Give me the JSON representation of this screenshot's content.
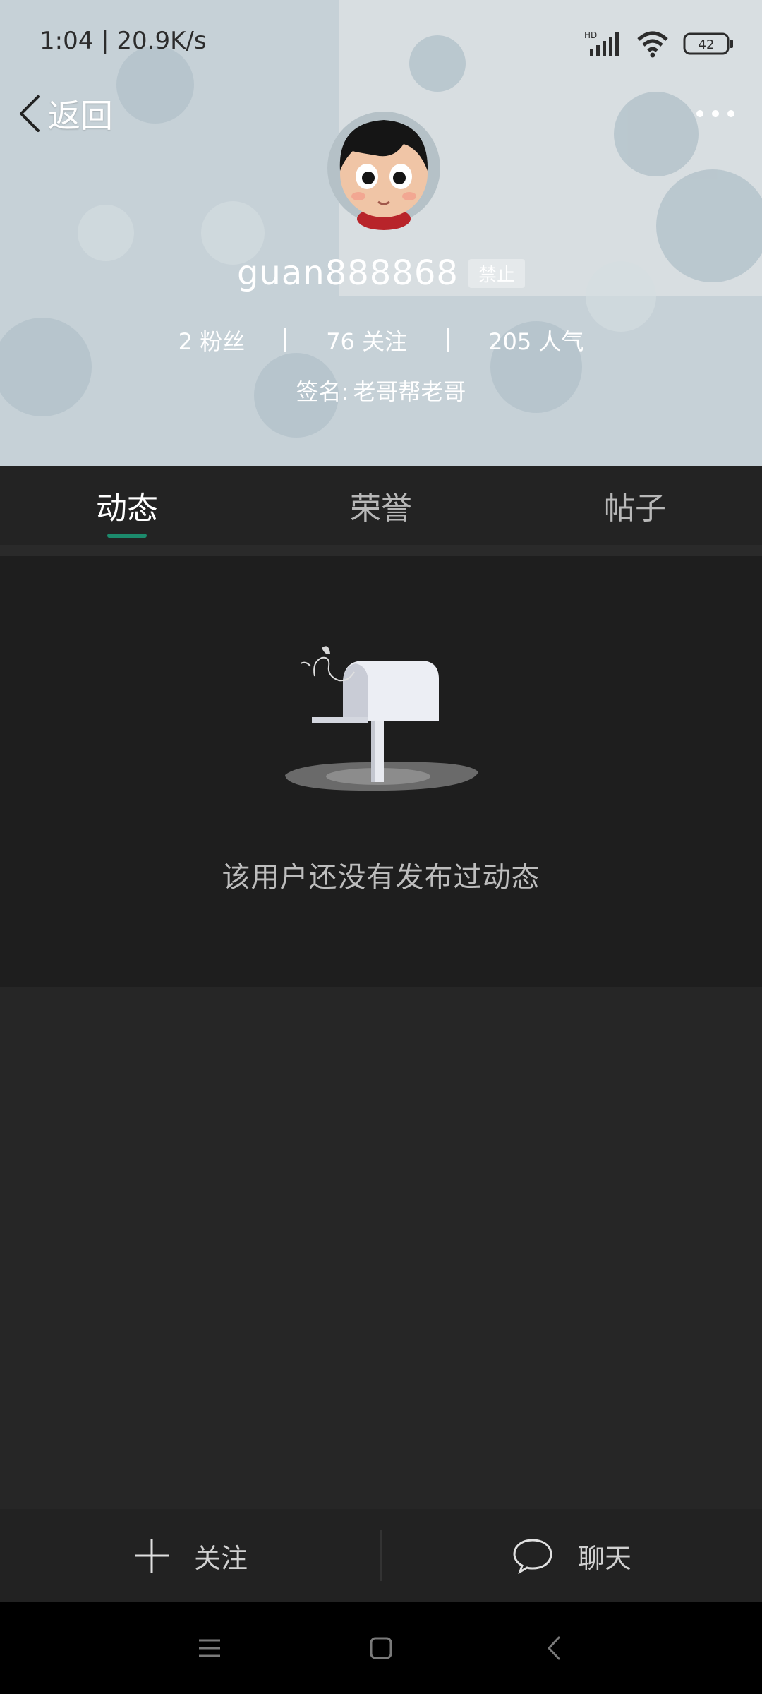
{
  "status_bar": {
    "time_speed": "1:04 | 20.9K/s",
    "battery": "42",
    "hd_label": "HD"
  },
  "header": {
    "back_label": "返回",
    "username": "guan888868",
    "ban_badge": "禁止",
    "stats": [
      {
        "text": "2 粉丝"
      },
      {
        "text": "76 关注"
      },
      {
        "text": "205 人气"
      }
    ],
    "signature_prefix": "签名:",
    "signature": "老哥帮老哥"
  },
  "tabs": [
    {
      "label": "动态",
      "active": true
    },
    {
      "label": "荣誉",
      "active": false
    },
    {
      "label": "帖子",
      "active": false
    }
  ],
  "empty_state": {
    "message": "该用户还没有发布过动态"
  },
  "actions": {
    "follow_label": "关注",
    "chat_label": "聊天"
  },
  "colors": {
    "accent": "#1c8a6c",
    "header_bg": "#c8d3d9",
    "panel_bg": "#1e1e1e"
  }
}
